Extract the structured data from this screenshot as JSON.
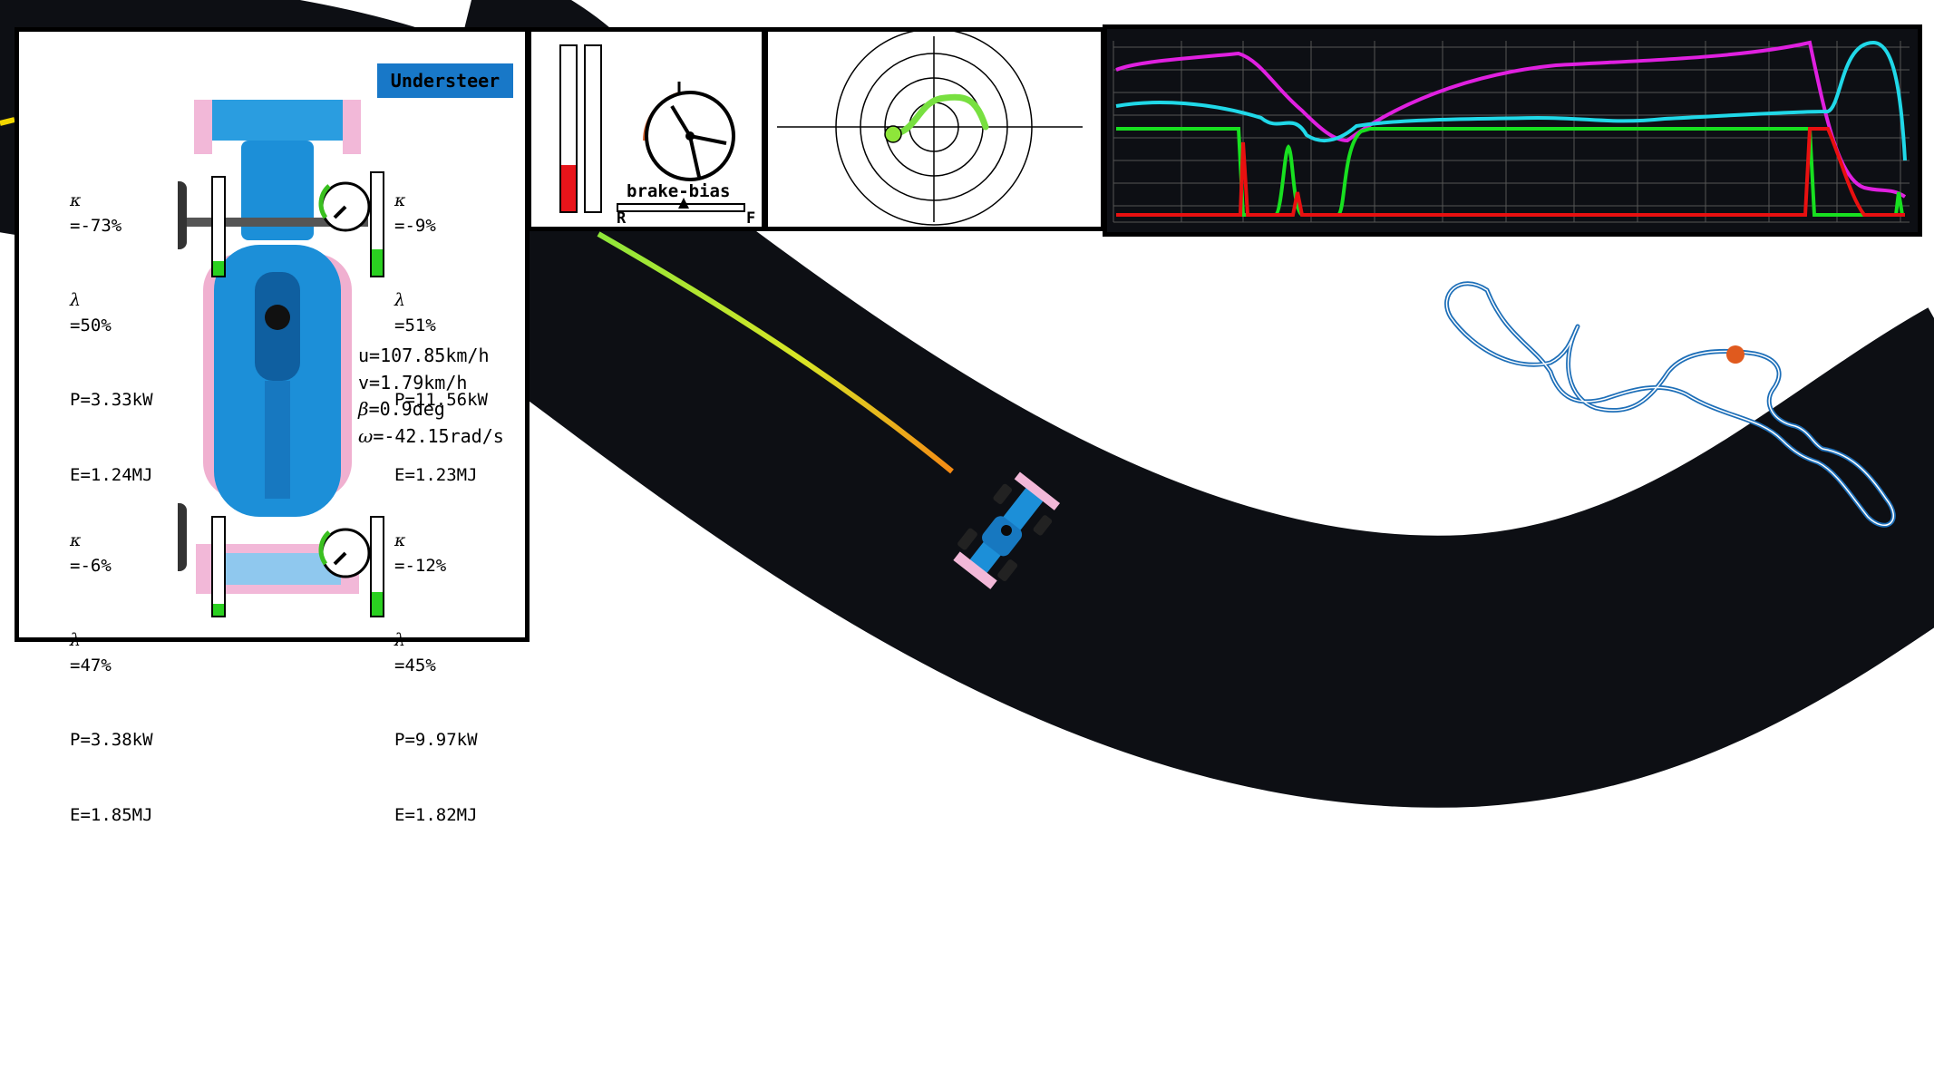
{
  "badge": {
    "label": "Understeer"
  },
  "tyres": {
    "front_left": {
      "kappa": "=-73%",
      "lambda": "=50%",
      "power": "P=3.33kW",
      "energy": "E=1.24MJ"
    },
    "front_right": {
      "kappa": "=-9%",
      "lambda": "=51%",
      "power": "P=11.56kW",
      "energy": "E=1.23MJ"
    },
    "rear_left": {
      "kappa": "=-6%",
      "lambda": "=47%",
      "power": "P=3.38kW",
      "energy": "E=1.85MJ"
    },
    "rear_right": {
      "kappa": "=-12%",
      "lambda": "=45%",
      "power": "P=9.97kW",
      "energy": "E=1.82MJ"
    }
  },
  "symbols": {
    "kappa": "κ",
    "lambda": "λ",
    "beta": "β",
    "omega": "ω"
  },
  "dynamics": {
    "u": "u=107.85km/h",
    "v": "v=1.79km/h",
    "beta": "=0.9deg",
    "omega": "=-42.15rad/s"
  },
  "pedals": {
    "brake_level": 0.28,
    "throttle_level": 0.0,
    "brake_bias_label": "brake-bias",
    "rear_label": "R",
    "front_label": "F"
  },
  "colors": {
    "track": "#0d0f14",
    "brake": "#e8141a",
    "minimap": "#1e6fb8",
    "minimap_marker": "#e05a1e",
    "badge": "#1878c8",
    "trace_magenta": "#e020e0",
    "trace_cyan": "#20d8e8",
    "trace_green": "#18e020",
    "trace_red": "#e81010"
  },
  "icons": {
    "steering": "steering-wheel-icon",
    "car": "race-car-icon"
  }
}
